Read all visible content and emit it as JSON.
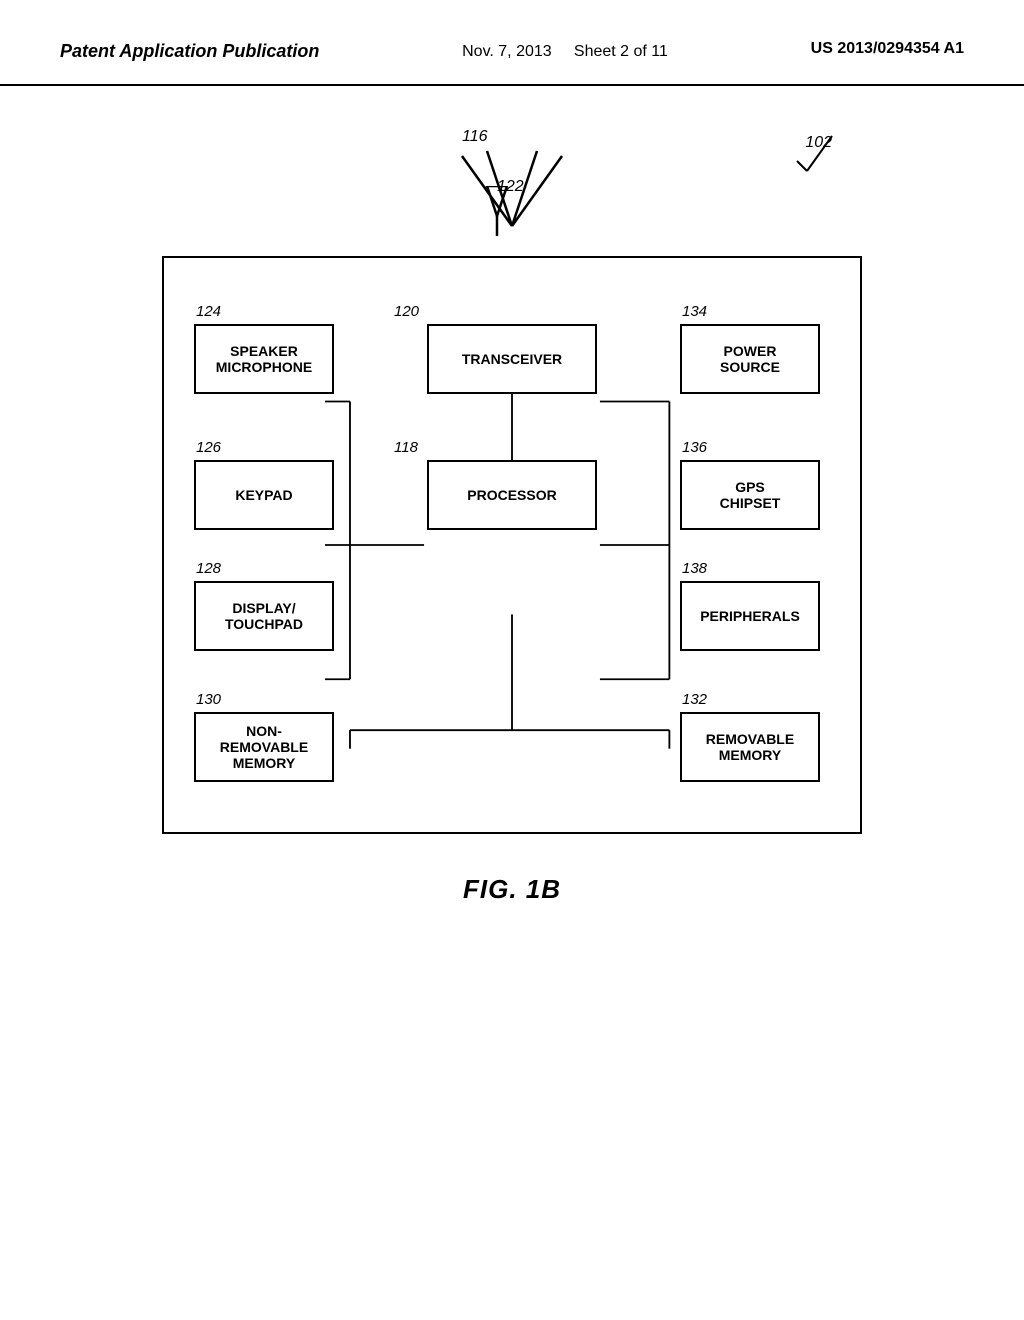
{
  "header": {
    "left": "Patent Application Publication",
    "center_date": "Nov. 7, 2013",
    "center_sheet": "Sheet 2 of 11",
    "right": "US 2013/0294354 A1"
  },
  "diagram": {
    "title": "FIG. 1B",
    "labels": {
      "ref_116": "116",
      "ref_122": "122",
      "ref_102": "102",
      "ref_120": "120",
      "ref_118": "118",
      "ref_124": "124",
      "ref_126": "126",
      "ref_128": "128",
      "ref_130": "130",
      "ref_132": "132",
      "ref_134": "134",
      "ref_136": "136",
      "ref_138": "138"
    },
    "boxes": {
      "transceiver": "TRANSCEIVER",
      "processor": "PROCESSOR",
      "speaker_microphone": "SPEAKER\nMICROPHONE",
      "keypad": "KEYPAD",
      "display_touchpad": "DISPLAY/\nTOUCHPAD",
      "power_source": "POWER\nSOURCE",
      "gps_chipset": "GPS\nCHIPSET",
      "peripherals": "PERIPHERALS",
      "non_removable_memory": "NON-REMOVABLE\nMEMORY",
      "removable_memory": "REMOVABLE\nMEMORY"
    }
  }
}
